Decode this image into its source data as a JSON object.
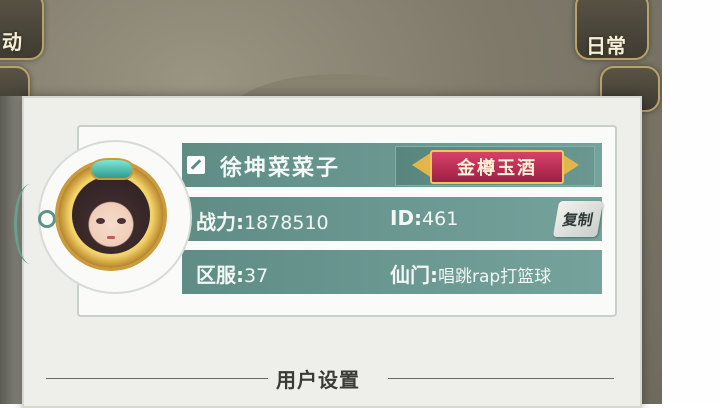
{
  "background": {
    "left_hud_label": "动",
    "right_hud_label": "日常"
  },
  "profile": {
    "name": "徐坤菜菜子",
    "title_badge": "金樽玉酒",
    "power_label": "战力:",
    "power_value": "1878510",
    "id_label": "ID:",
    "id_value": "461",
    "copy_label": "复制",
    "server_label": "区服:",
    "server_value": "37",
    "sect_label": "仙门:",
    "sect_value": "唱跳rap打篮球"
  },
  "section": {
    "title": "用户设置"
  },
  "colors": {
    "row_bg": "#5f8d86",
    "badge_red": "#c02a55",
    "gold": "#e2b64a",
    "panel_bg": "#eeeeea"
  },
  "icons": {
    "edit": "pencil-icon",
    "copy": "copy-button"
  }
}
